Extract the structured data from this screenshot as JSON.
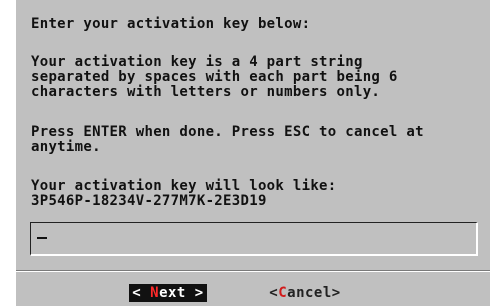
{
  "dialog": {
    "prompt": "Enter your activation key below:",
    "description": "Your activation key is a 4 part string\nseparated by spaces with each part being 6\ncharacters with letters or numbers only.",
    "instructions": "Press ENTER when done. Press ESC to cancel at\nanytime.",
    "example_label": "Your activation key will look like:",
    "example_key": "3P546P-18234V-277M7K-2E3D19"
  },
  "input": {
    "value": ""
  },
  "buttons": {
    "next": {
      "left_bracket": "<",
      "hotkey": "N",
      "rest": "ext",
      "right_bracket": ">"
    },
    "cancel": {
      "left_bracket": "<",
      "hotkey": "C",
      "rest": "ancel",
      "right_bracket": ">"
    }
  },
  "colors": {
    "dialog_background": "#c0c0c0",
    "selected_button_background": "#111111",
    "hotkey": "#ff2a2a"
  }
}
